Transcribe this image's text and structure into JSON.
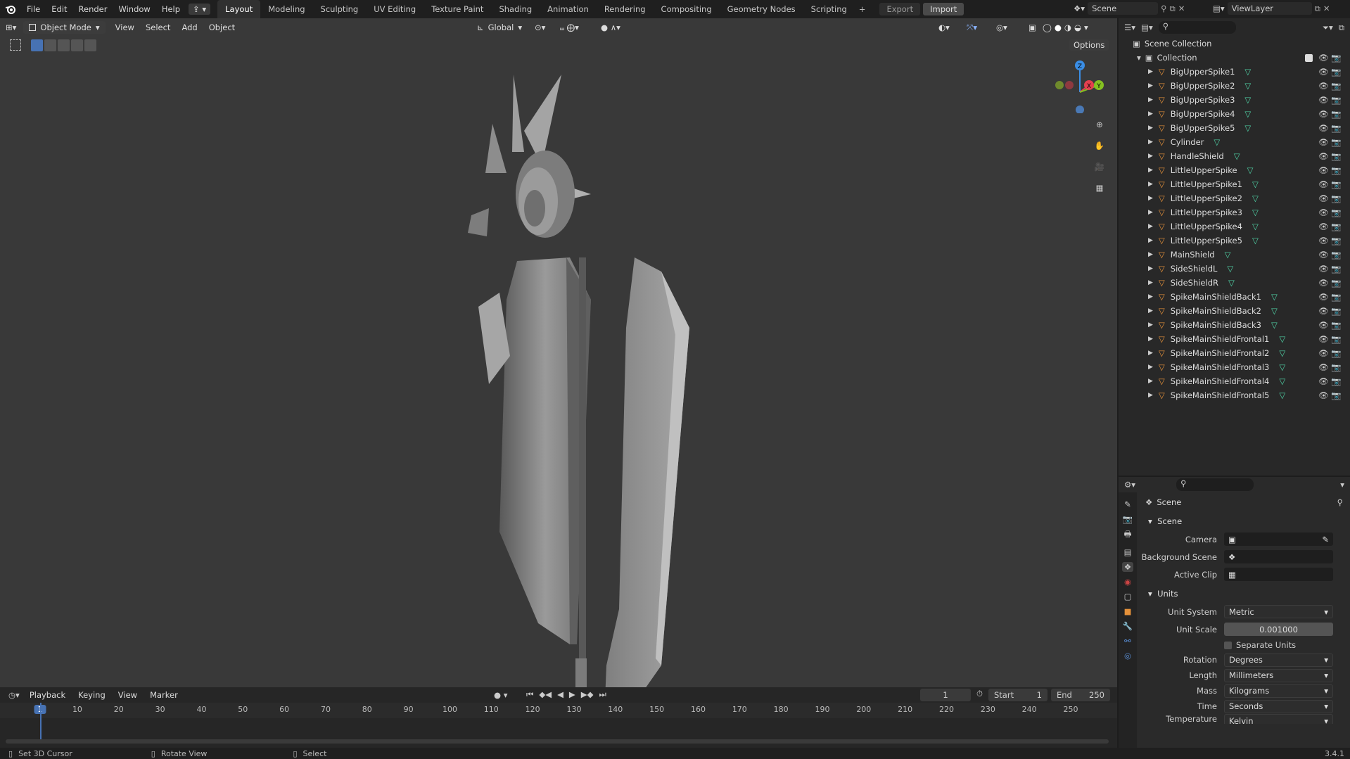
{
  "menu": [
    "File",
    "Edit",
    "Render",
    "Window",
    "Help"
  ],
  "workspace_tabs": [
    "Layout",
    "Modeling",
    "Sculpting",
    "UV Editing",
    "Texture Paint",
    "Shading",
    "Animation",
    "Rendering",
    "Compositing",
    "Geometry Nodes",
    "Scripting"
  ],
  "active_tab": "Layout",
  "export_label": "Export",
  "import_label": "Import",
  "scene_name": "Scene",
  "view_layer": "ViewLayer",
  "viewport": {
    "mode": "Object Mode",
    "menus": [
      "View",
      "Select",
      "Add",
      "Object"
    ],
    "orientation": "Global",
    "options_label": "Options",
    "gizmo_axes": {
      "z": "Z",
      "x": "X",
      "y": "Y"
    }
  },
  "outliner": {
    "scene_collection": "Scene Collection",
    "collection": "Collection",
    "items": [
      "BigUpperSpike1",
      "BigUpperSpike2",
      "BigUpperSpike3",
      "BigUpperSpike4",
      "BigUpperSpike5",
      "Cylinder",
      "HandleShield",
      "LittleUpperSpike",
      "LittleUpperSpike1",
      "LittleUpperSpike2",
      "LittleUpperSpike3",
      "LittleUpperSpike4",
      "LittleUpperSpike5",
      "MainShield",
      "SideShieldL",
      "SideShieldR",
      "SpikeMainShieldBack1",
      "SpikeMainShieldBack2",
      "SpikeMainShieldBack3",
      "SpikeMainShieldFrontal1",
      "SpikeMainShieldFrontal2",
      "SpikeMainShieldFrontal3",
      "SpikeMainShieldFrontal4",
      "SpikeMainShieldFrontal5"
    ]
  },
  "properties": {
    "context": "Scene",
    "scene_section": "Scene",
    "camera_label": "Camera",
    "bg_scene_label": "Background Scene",
    "active_clip_label": "Active Clip",
    "units_section": "Units",
    "unit_system_label": "Unit System",
    "unit_system": "Metric",
    "unit_scale_label": "Unit Scale",
    "unit_scale": "0.001000",
    "separate_units": "Separate Units",
    "rotation_label": "Rotation",
    "rotation": "Degrees",
    "length_label": "Length",
    "length": "Millimeters",
    "mass_label": "Mass",
    "mass": "Kilograms",
    "time_label": "Time",
    "time": "Seconds",
    "temperature_label": "Temperature",
    "temperature": "Kelvin"
  },
  "timeline": {
    "menus": [
      "Playback",
      "Keying",
      "View",
      "Marker"
    ],
    "current_frame": "1",
    "start_label": "Start",
    "start": "1",
    "end_label": "End",
    "end": "250",
    "ticks": [
      "1",
      "10",
      "20",
      "30",
      "40",
      "50",
      "60",
      "70",
      "80",
      "90",
      "100",
      "110",
      "120",
      "130",
      "140",
      "150",
      "160",
      "170",
      "180",
      "190",
      "200",
      "210",
      "220",
      "230",
      "240",
      "250"
    ]
  },
  "status": {
    "left": "Set 3D Cursor",
    "middle": "Rotate View",
    "right": "Select",
    "version": "3.4.1"
  },
  "colors": {
    "accent": "#4772b3",
    "object_icon": "#e5913a",
    "mesh_icon": "#4fd1a5",
    "x_axis": "#e43f4f",
    "y_axis": "#84c021",
    "z_axis": "#3a8ee6"
  }
}
